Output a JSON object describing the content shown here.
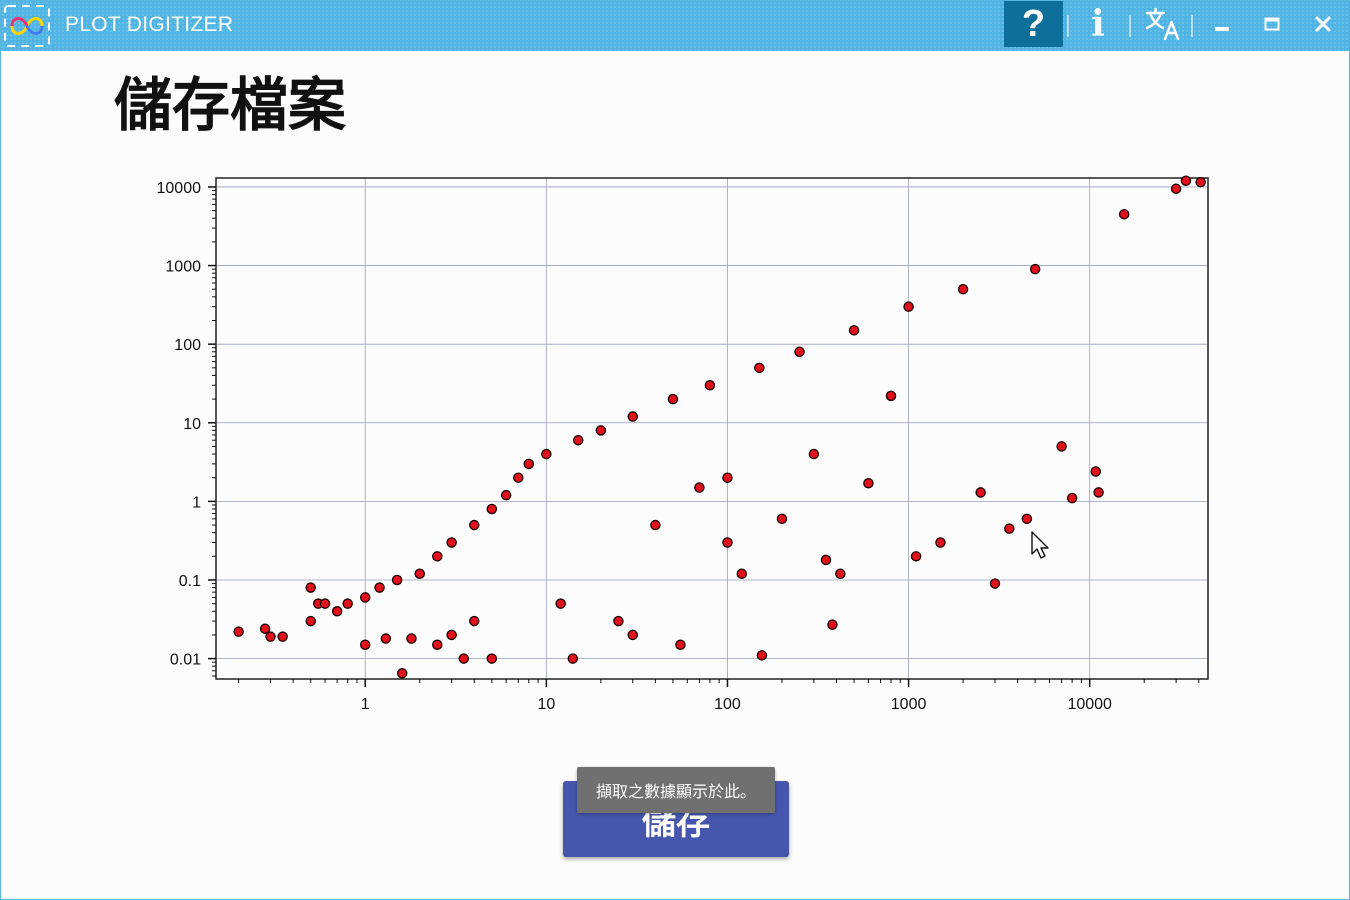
{
  "window": {
    "title": "PLOT DIGITIZER",
    "controls": {
      "help": "?",
      "info": "i",
      "language_icon": "translate-icon",
      "minimize_icon": "minimize-icon",
      "maximize_icon": "maximize-icon",
      "close_icon": "close-icon"
    }
  },
  "page": {
    "title": "儲存檔案",
    "save_button": "儲存",
    "tooltip": "擷取之數據顯示於此。"
  },
  "colors": {
    "titlebar": "#4fb3e3",
    "help_active": "#0e6f9a",
    "save_button": "#4656ad",
    "marker_fill": "#e0101c",
    "marker_edge": "#1a0000"
  },
  "chart_data": {
    "type": "scatter",
    "xscale": "log",
    "yscale": "log",
    "xlim": [
      0.15,
      45000
    ],
    "ylim": [
      0.0055,
      13000
    ],
    "xticks": [
      1,
      10,
      100,
      1000,
      10000
    ],
    "xtick_labels": [
      "1",
      "10",
      "100",
      "1000",
      "10000"
    ],
    "yticks": [
      0.01,
      0.1,
      1,
      10,
      100,
      1000,
      10000
    ],
    "ytick_labels": [
      "0.01",
      "0.1",
      "1",
      "10",
      "100",
      "1000",
      "10000"
    ],
    "grid": true,
    "series": [
      {
        "points": [
          [
            0.2,
            0.022
          ],
          [
            0.28,
            0.024
          ],
          [
            0.3,
            0.019
          ],
          [
            0.35,
            0.019
          ],
          [
            0.5,
            0.08
          ],
          [
            0.5,
            0.03
          ],
          [
            0.55,
            0.05
          ],
          [
            0.6,
            0.05
          ],
          [
            0.7,
            0.04
          ],
          [
            0.8,
            0.05
          ],
          [
            1.0,
            0.06
          ],
          [
            1.0,
            0.015
          ],
          [
            1.2,
            0.08
          ],
          [
            1.3,
            0.018
          ],
          [
            1.5,
            0.1
          ],
          [
            1.6,
            0.0065
          ],
          [
            1.8,
            0.018
          ],
          [
            2.0,
            0.12
          ],
          [
            2.5,
            0.2
          ],
          [
            2.5,
            0.015
          ],
          [
            3.0,
            0.3
          ],
          [
            3.0,
            0.02
          ],
          [
            3.5,
            0.01
          ],
          [
            4.0,
            0.5
          ],
          [
            4.0,
            0.03
          ],
          [
            5.0,
            0.8
          ],
          [
            5.0,
            0.01
          ],
          [
            6.0,
            1.2
          ],
          [
            7.0,
            2.0
          ],
          [
            8.0,
            3.0
          ],
          [
            10.0,
            4.0
          ],
          [
            12.0,
            0.05
          ],
          [
            14.0,
            0.01
          ],
          [
            15.0,
            6.0
          ],
          [
            20.0,
            8.0
          ],
          [
            25.0,
            0.03
          ],
          [
            30.0,
            12.0
          ],
          [
            30.0,
            0.02
          ],
          [
            40.0,
            0.5
          ],
          [
            50.0,
            20.0
          ],
          [
            55.0,
            0.015
          ],
          [
            70.0,
            1.5
          ],
          [
            80.0,
            30.0
          ],
          [
            100.0,
            2.0
          ],
          [
            100.0,
            0.3
          ],
          [
            120.0,
            0.12
          ],
          [
            150.0,
            50.0
          ],
          [
            155.0,
            0.011
          ],
          [
            200.0,
            0.6
          ],
          [
            250.0,
            80.0
          ],
          [
            300.0,
            4.0
          ],
          [
            350.0,
            0.18
          ],
          [
            380.0,
            0.027
          ],
          [
            420.0,
            0.12
          ],
          [
            500.0,
            150.0
          ],
          [
            600.0,
            1.7
          ],
          [
            800.0,
            22.0
          ],
          [
            1000.0,
            300.0
          ],
          [
            1100.0,
            0.2
          ],
          [
            1500.0,
            0.3
          ],
          [
            2000.0,
            500.0
          ],
          [
            2500.0,
            1.3
          ],
          [
            3000.0,
            0.09
          ],
          [
            3600.0,
            0.45
          ],
          [
            4500.0,
            0.6
          ],
          [
            5000.0,
            900.0
          ],
          [
            7000.0,
            5.0
          ],
          [
            8000.0,
            1.1
          ],
          [
            10800.0,
            2.4
          ],
          [
            11200.0,
            1.3
          ],
          [
            15500.0,
            4500.0
          ],
          [
            30000.0,
            9500.0
          ],
          [
            34000.0,
            12000.0
          ],
          [
            41000.0,
            11500.0
          ]
        ]
      }
    ]
  }
}
